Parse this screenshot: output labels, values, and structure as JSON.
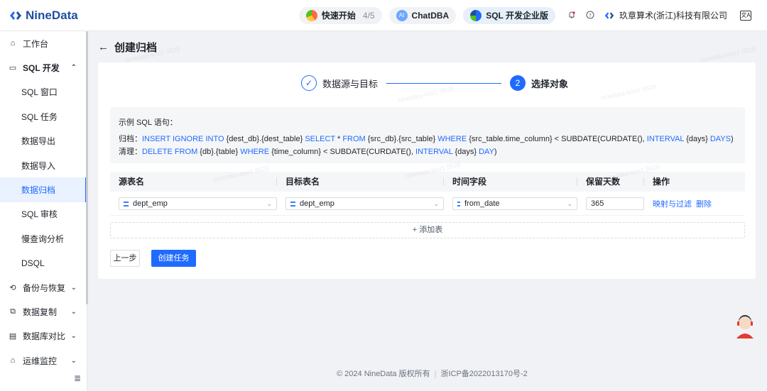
{
  "brand": {
    "name": "NineData"
  },
  "topbar": {
    "quickstart_label": "快速开始",
    "quickstart_count": "4/5",
    "chatdba_label": "ChatDBA",
    "sql_edition_label": "SQL 开发企业版",
    "company": "玖章算术(浙江)科技有限公司",
    "lang_label": "文A"
  },
  "sidebar": {
    "items": [
      {
        "label": "工作台",
        "icon": "home-icon"
      },
      {
        "label": "SQL 开发",
        "icon": "monitor-icon",
        "chevron": "^"
      },
      {
        "label": "SQL 窗口"
      },
      {
        "label": "SQL 任务"
      },
      {
        "label": "数据导出"
      },
      {
        "label": "数据导入"
      },
      {
        "label": "数据归档"
      },
      {
        "label": "SQL 审核"
      },
      {
        "label": "慢查询分析"
      },
      {
        "label": "DSQL"
      },
      {
        "label": "备份与恢复",
        "icon": "backup-icon",
        "chevron": "v"
      },
      {
        "label": "数据复制",
        "icon": "copy-icon",
        "chevron": "v"
      },
      {
        "label": "数据库对比",
        "icon": "compare-icon",
        "chevron": "v"
      },
      {
        "label": "运维监控",
        "icon": "monitor-ops-icon",
        "chevron": "v"
      }
    ]
  },
  "page": {
    "title": "创建归档",
    "back_glyph": "←"
  },
  "steps": {
    "step1_label": "数据源与目标",
    "step2_num": "2",
    "step2_label": "选择对象"
  },
  "sample": {
    "title": "示例 SQL 语句：",
    "archive_prefix": "归档：",
    "archive_kw1": "INSERT IGNORE INTO",
    "archive_t1": " {dest_db}.{dest_table} ",
    "archive_kw2": "SELECT",
    "archive_t2": " * ",
    "archive_kw3": "FROM",
    "archive_t3": " {src_db}.{src_table} ",
    "archive_kw4": "WHERE",
    "archive_t4": " {src_table.time_column} < SUBDATE(CURDATE(), ",
    "archive_kw5": "INTERVAL",
    "archive_t5": " {days} ",
    "archive_kw6": "DAYS",
    "archive_t6": ")",
    "clean_prefix": "清理：",
    "clean_kw1": "DELETE FROM",
    "clean_t1": " {db}.{table} ",
    "clean_kw2": "WHERE",
    "clean_t2": " {time_column} < SUBDATE(CURDATE(), ",
    "clean_kw3": "INTERVAL",
    "clean_t3": " {days} ",
    "clean_kw4": "DAY",
    "clean_t4": ")"
  },
  "table": {
    "columns": [
      "源表名",
      "目标表名",
      "时间字段",
      "保留天数",
      "操作"
    ],
    "row": {
      "source_table": "dept_emp",
      "target_table": "dept_emp",
      "time_field": "from_date",
      "retention_days": "365",
      "action_map": "映射与过滤",
      "action_delete": "删除"
    },
    "add_label": "+ 添加表"
  },
  "buttons": {
    "prev": "上一步",
    "create": "创建任务"
  },
  "footer": {
    "copyright": "© 2024 NineData 版权所有",
    "icp": "浙ICP备2022013170号-2"
  },
  "watermark": "ninedata-test1 9528",
  "colors": {
    "primary": "#1f6bff",
    "brand": "#1f4f9e"
  }
}
